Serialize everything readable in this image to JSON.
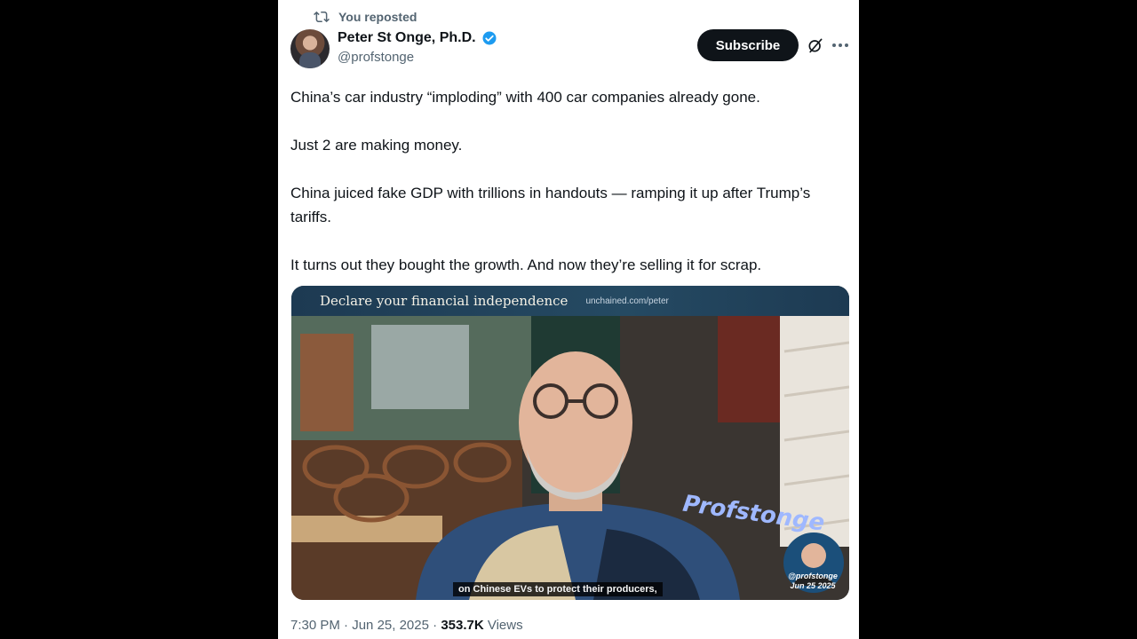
{
  "repost": {
    "label": "You reposted",
    "icon": "repost-icon"
  },
  "author": {
    "name": "Peter St Onge, Ph.D.",
    "handle": "@profstonge",
    "verified_icon": "verified-badge-icon",
    "verified_color": "#1d9bf0"
  },
  "actions": {
    "subscribe_label": "Subscribe",
    "grok_icon": "grok-icon",
    "more_icon": "more-icon"
  },
  "tweet": {
    "paragraphs": [
      "China’s car industry “imploding” with 400 car companies already gone.",
      "Just 2 are making money.",
      "China juiced fake GDP with trillions in handouts — ramping it up after Trump’s tariffs.",
      "It turns out they bought the growth. And now they’re selling it for scrap."
    ]
  },
  "media": {
    "banner_title": "Declare your financial independence",
    "banner_url": "unchained.com/peter",
    "caption": "on Chinese EVs to protect their producers,",
    "pip_handle": "@profstonge",
    "pip_date": "Jun 25 2025"
  },
  "meta": {
    "time": "7:30 PM",
    "date": "Jun 25, 2025",
    "separator": "·",
    "views_count": "353.7K",
    "views_label": "Views"
  },
  "colors": {
    "background": "#000000",
    "card": "#ffffff",
    "text": "#0f1419",
    "muted": "#536471",
    "button": "#0f1419"
  }
}
